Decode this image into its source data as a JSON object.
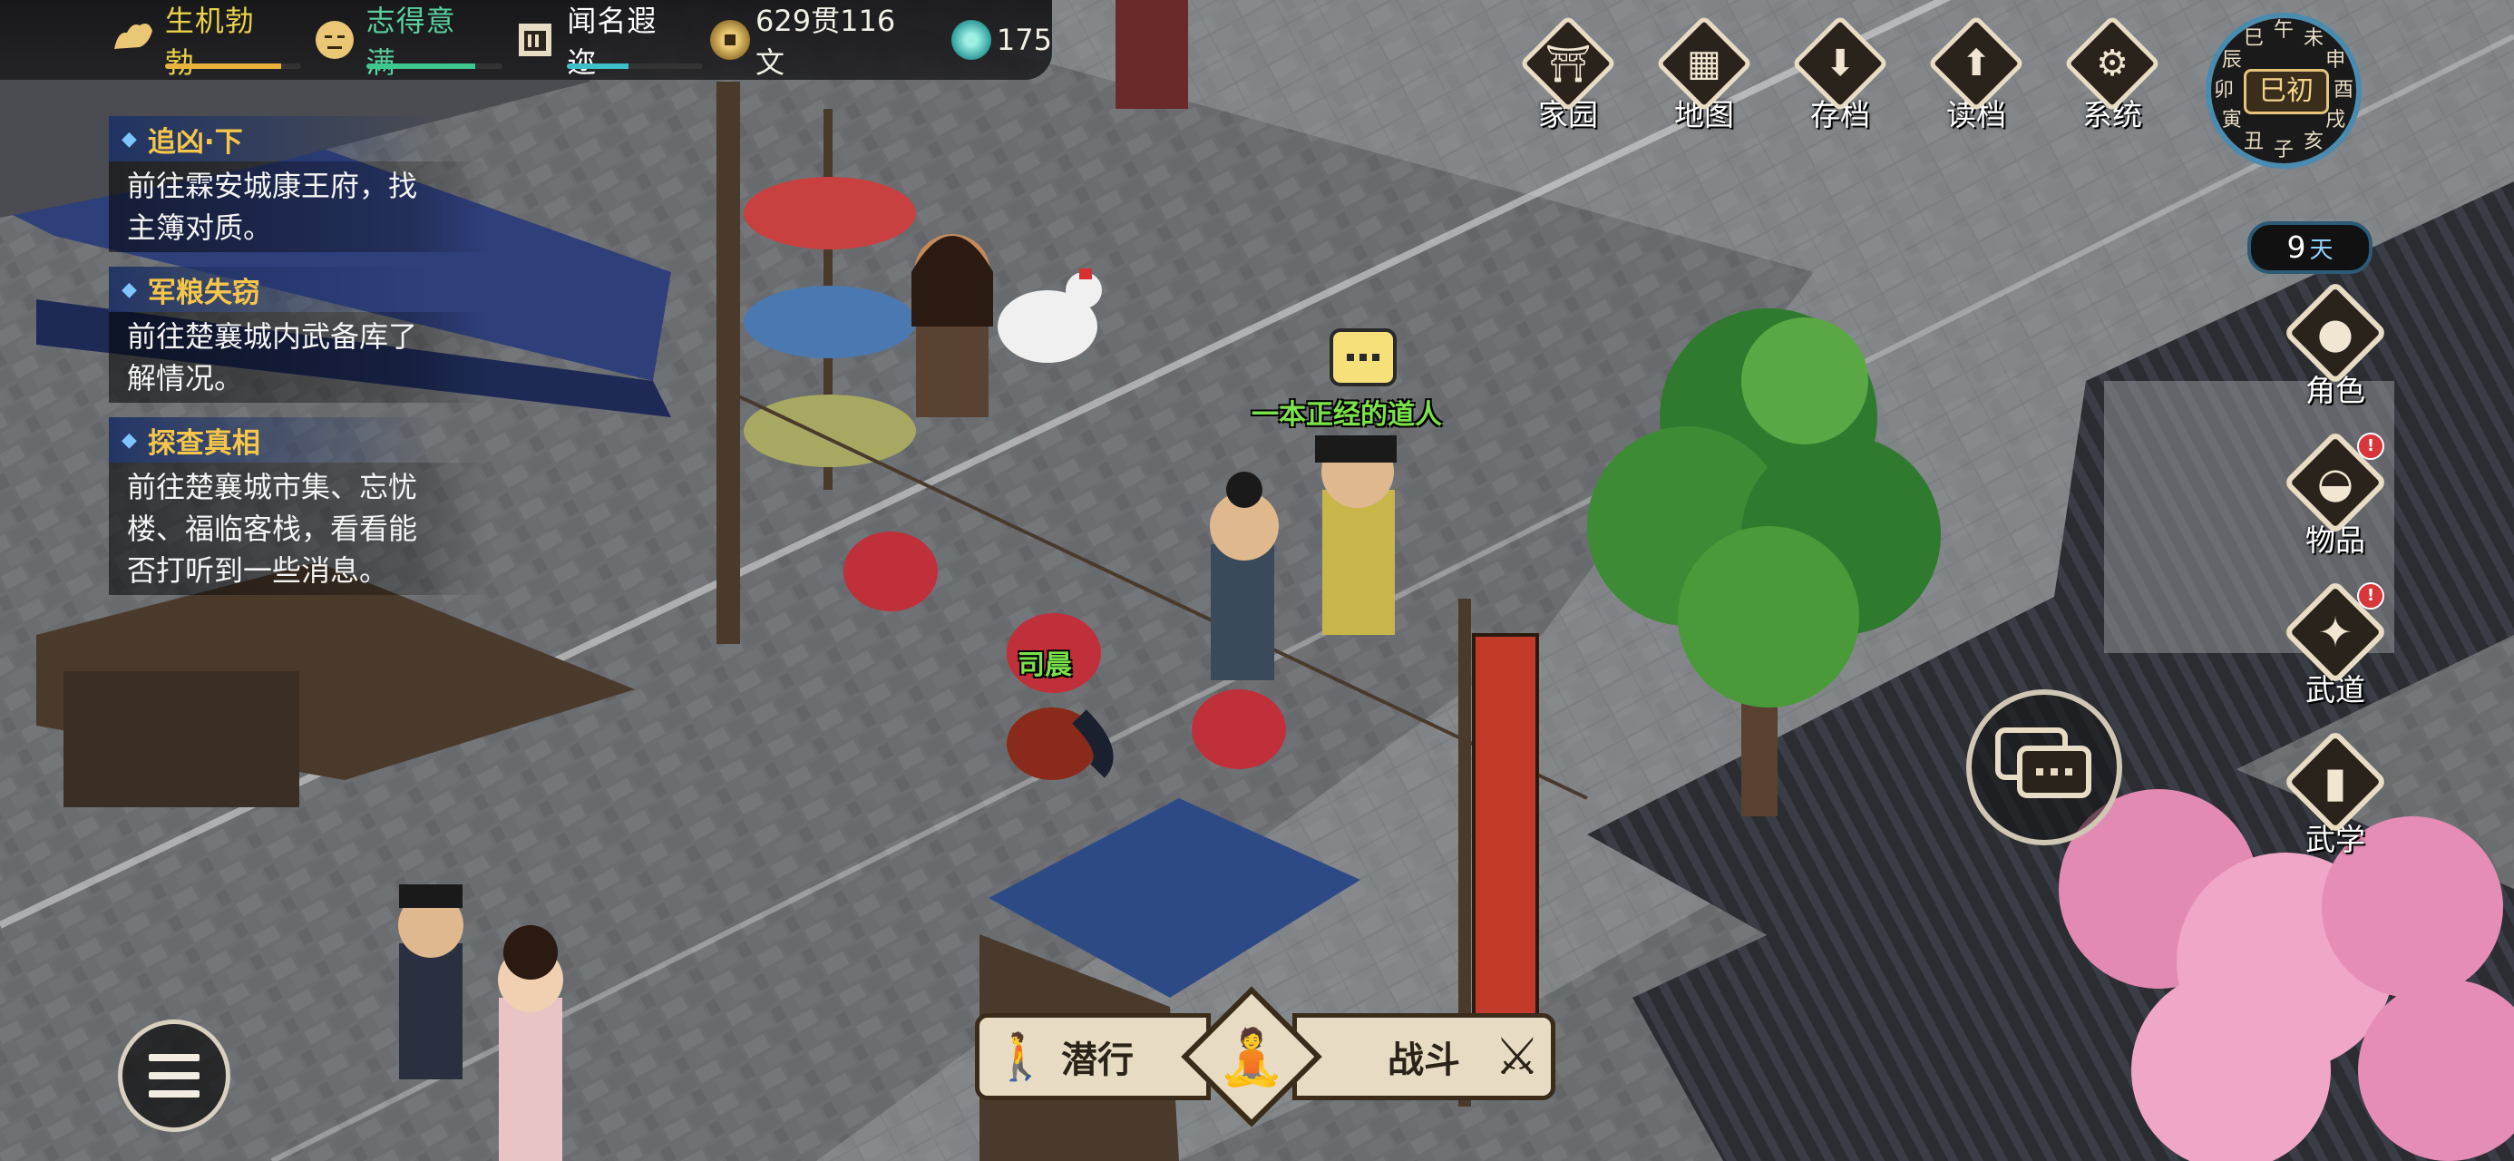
{
  "status": {
    "stats": [
      {
        "label": "生机勃勃",
        "color": "#e9d24a",
        "icon": "muscle-icon",
        "fill": 0.85,
        "barColor": "#e9b23c"
      },
      {
        "label": "志得意满",
        "color": "#59d09e",
        "icon": "face-icon",
        "fill": 0.8,
        "barColor": "#3ec890"
      },
      {
        "label": "闻名遐迩",
        "color": "#ffffff",
        "icon": "plaque-icon",
        "fill": 0.45,
        "barColor": "#3fbfc9"
      }
    ],
    "money": "629贯116文",
    "jade": "175"
  },
  "quests": [
    {
      "title": "追凶·下",
      "desc": "前往霖安城康王府，找\n主簿对质。"
    },
    {
      "title": "军粮失窃",
      "desc": "前往楚襄城内武备库了\n解情况。"
    },
    {
      "title": "探查真相",
      "desc": "前往楚襄城市集、忘忧\n楼、福临客栈，看看能\n否打听到一些消息。"
    }
  ],
  "topmenu": [
    {
      "label": "家园",
      "icon": "gate-icon"
    },
    {
      "label": "地图",
      "icon": "map-icon"
    },
    {
      "label": "存档",
      "icon": "save-icon"
    },
    {
      "label": "读档",
      "icon": "load-icon"
    },
    {
      "label": "系统",
      "icon": "gear-icon"
    }
  ],
  "clock": {
    "current": "巳初",
    "hours": [
      "子",
      "丑",
      "寅",
      "卯",
      "辰",
      "巳",
      "午",
      "未",
      "申",
      "酉",
      "戌",
      "亥"
    ],
    "day_number": "9",
    "day_unit": "天"
  },
  "sidemenu": [
    {
      "label": "角色",
      "icon": "person-icon",
      "badge": false
    },
    {
      "label": "物品",
      "icon": "bag-icon",
      "badge": true
    },
    {
      "label": "武道",
      "icon": "constellation-icon",
      "badge": true
    },
    {
      "label": "武学",
      "icon": "book-icon",
      "badge": false
    }
  ],
  "badge_mark": "!",
  "actions": {
    "sneak": "潜行",
    "fight": "战斗",
    "meditate_icon": "meditate-icon"
  },
  "npcs": {
    "taoist": "一本正经的道人",
    "player": "司晨"
  },
  "colors": {
    "npc_label": "#7be24a",
    "quest_title": "#f6c64a",
    "accent_blue": "#4a8bb0"
  }
}
